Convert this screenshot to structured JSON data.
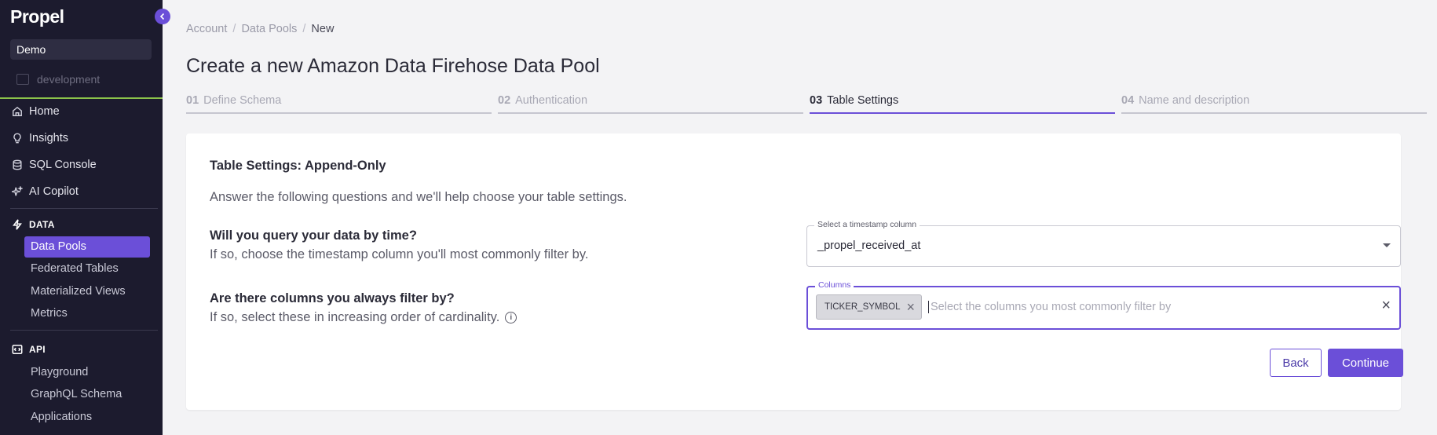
{
  "sidebar": {
    "logo": "Propel",
    "org": "Demo",
    "environment": "development",
    "nav": [
      {
        "label": "Home",
        "icon": "home-icon"
      },
      {
        "label": "Insights",
        "icon": "lightbulb-icon"
      },
      {
        "label": "SQL Console",
        "icon": "database-icon"
      },
      {
        "label": "AI Copilot",
        "icon": "sparkle-icon"
      }
    ],
    "data_section": {
      "title": "DATA",
      "items": [
        "Data Pools",
        "Federated Tables",
        "Materialized Views",
        "Metrics"
      ],
      "active": "Data Pools"
    },
    "api_section": {
      "title": "API",
      "items": [
        "Playground",
        "GraphQL Schema",
        "Applications"
      ]
    }
  },
  "breadcrumb": {
    "items": [
      "Account",
      "Data Pools",
      "New"
    ],
    "separator": "/"
  },
  "page": {
    "title": "Create a new Amazon Data Firehose Data Pool"
  },
  "steps": [
    {
      "num": "01",
      "label": "Define Schema",
      "active": false
    },
    {
      "num": "02",
      "label": "Authentication",
      "active": false
    },
    {
      "num": "03",
      "label": "Table Settings",
      "active": true
    },
    {
      "num": "04",
      "label": "Name and description",
      "active": false
    }
  ],
  "card": {
    "title": "Table Settings: Append-Only",
    "intro": "Answer the following questions and we'll help choose your table settings.",
    "q1": {
      "title": "Will you query your data by time?",
      "desc": "If so, choose the timestamp column you'll most commonly filter by."
    },
    "q2": {
      "title": "Are there columns you always filter by?",
      "desc": "If so, select these in increasing order of cardinality."
    },
    "timestamp_field": {
      "label": "Select a timestamp column",
      "value": "_propel_received_at"
    },
    "columns_field": {
      "label": "Columns",
      "chips": [
        "TICKER_SYMBOL"
      ],
      "placeholder": "Select the columns you most commonly filter by"
    },
    "back_label": "Back",
    "continue_label": "Continue"
  },
  "colors": {
    "accent": "#6b4fd8",
    "sidebar_bg": "#1c1b2e",
    "env_bar": "#8bc34a"
  }
}
